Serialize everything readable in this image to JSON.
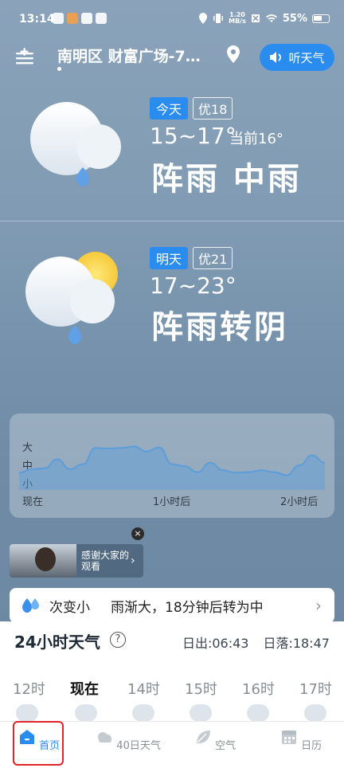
{
  "status_bar": {
    "time": "13:14",
    "speed_top": "1.20",
    "speed_bottom": "MB/s",
    "battery": "55%"
  },
  "header": {
    "location": "南明区 财富广场-7…",
    "listen_label": "听天气"
  },
  "today": {
    "tag": "今天",
    "aqi": "优18",
    "temp_range": "15~17°",
    "current": "当前16°",
    "weather": "阵雨  中雨"
  },
  "tomorrow": {
    "tag": "明天",
    "aqi": "优21",
    "temp_range": "17~23°",
    "weather": "阵雨转阴"
  },
  "precip_chart": {
    "y_labels": [
      "大",
      "中",
      "小"
    ],
    "x_labels": [
      "现在",
      "1小时后",
      "2小时后"
    ]
  },
  "chart_data": {
    "type": "area",
    "title": "",
    "ylabel": "",
    "xlabel": "",
    "y_categories": [
      "小",
      "中",
      "大"
    ],
    "x_ticks": [
      "现在",
      "1小时后",
      "2小时后"
    ],
    "ylim": [
      0,
      1
    ],
    "x": [
      0,
      5,
      10,
      15,
      20,
      25,
      30,
      35,
      40,
      45,
      50,
      55,
      60,
      65,
      70,
      75,
      80,
      85,
      90,
      95,
      100,
      105,
      110,
      115,
      120
    ],
    "values": [
      0.35,
      0.42,
      0.44,
      0.62,
      0.42,
      0.52,
      0.85,
      0.84,
      0.85,
      0.88,
      0.78,
      0.86,
      0.52,
      0.48,
      0.36,
      0.55,
      0.4,
      0.35,
      0.36,
      0.4,
      0.36,
      0.3,
      0.5,
      0.7,
      0.55
    ],
    "color": "#5b9ddb"
  },
  "ad": {
    "text": "感谢大家的观看",
    "close": "×"
  },
  "rain_bar": {
    "text1": "次变小",
    "text2": "雨渐大，18分钟后转为中"
  },
  "hourly": {
    "title": "24小时天气",
    "help": "?",
    "sunrise": "日出:06:43",
    "sunset": "日落:18:47",
    "hours": [
      "12时",
      "现在",
      "14时",
      "15时",
      "16时",
      "17时"
    ]
  },
  "tabs": [
    {
      "label": "首页",
      "icon": "home-icon"
    },
    {
      "label": "40日天气",
      "icon": "cloud-icon"
    },
    {
      "label": "空气",
      "icon": "leaf-icon"
    },
    {
      "label": "日历",
      "icon": "calendar-icon"
    }
  ],
  "colors": {
    "accent": "#2b8cf0",
    "highlight": "#e0242a"
  }
}
